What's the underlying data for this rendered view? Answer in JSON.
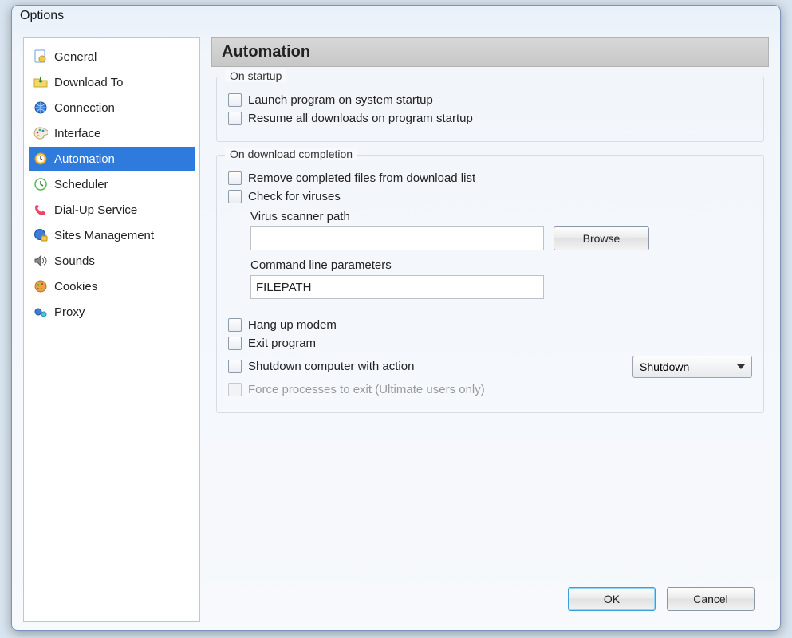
{
  "window": {
    "title": "Options"
  },
  "sidebar": {
    "items": [
      {
        "label": "General",
        "icon": "gear-page-icon"
      },
      {
        "label": "Download To",
        "icon": "folder-download-icon"
      },
      {
        "label": "Connection",
        "icon": "globe-icon"
      },
      {
        "label": "Interface",
        "icon": "palette-icon"
      },
      {
        "label": "Automation",
        "icon": "clock-gear-icon",
        "selected": true
      },
      {
        "label": "Scheduler",
        "icon": "clock-icon"
      },
      {
        "label": "Dial-Up Service",
        "icon": "phone-icon"
      },
      {
        "label": "Sites Management",
        "icon": "globe-lock-icon"
      },
      {
        "label": "Sounds",
        "icon": "speaker-icon"
      },
      {
        "label": "Cookies",
        "icon": "cookie-icon"
      },
      {
        "label": "Proxy",
        "icon": "proxy-icon"
      }
    ]
  },
  "page": {
    "title": "Automation"
  },
  "startup": {
    "legend": "On startup",
    "launch_label": "Launch program on system startup",
    "resume_label": "Resume all downloads on program startup"
  },
  "completion": {
    "legend": "On download completion",
    "remove_label": "Remove completed files from download list",
    "check_viruses_label": "Check for viruses",
    "scanner_path_label": "Virus scanner path",
    "scanner_path_value": "",
    "browse_label": "Browse",
    "cmd_params_label": "Command line parameters",
    "cmd_params_value": "FILEPATH",
    "hangup_label": "Hang up modem",
    "exit_label": "Exit program",
    "shutdown_label": "Shutdown computer with action",
    "shutdown_action": "Shutdown",
    "force_exit_label": "Force processes to exit (Ultimate users only)"
  },
  "footer": {
    "ok_label": "OK",
    "cancel_label": "Cancel"
  }
}
